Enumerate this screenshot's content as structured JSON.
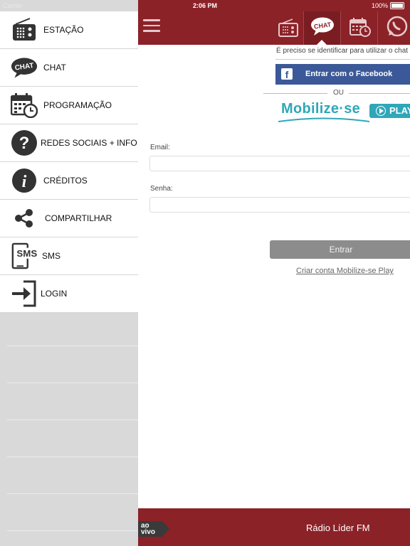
{
  "status_bar": {
    "carrier": "Carrier",
    "time": "2:06 PM",
    "battery": "100%"
  },
  "sidebar": {
    "items": [
      {
        "icon": "radio-icon",
        "label": "ESTAÇÃO"
      },
      {
        "icon": "chat-bubble-icon",
        "label": "CHAT"
      },
      {
        "icon": "calendar-clock-icon",
        "label": "PROGRAMAÇÃO"
      },
      {
        "icon": "question-icon",
        "label": "REDES SOCIAIS + INFO"
      },
      {
        "icon": "info-icon",
        "label": "CRÉDITOS"
      },
      {
        "icon": "share-icon",
        "label": "COMPARTILHAR"
      },
      {
        "icon": "sms-phone-icon",
        "label": "SMS"
      },
      {
        "icon": "login-icon",
        "label": "LOGIN"
      }
    ]
  },
  "header": {
    "icons": [
      "menu-icon",
      "radio-icon",
      "chat-icon",
      "calendar-icon",
      "whatsapp-icon"
    ],
    "chat_icon_text": "CHAT",
    "accent": "#8b2228"
  },
  "login": {
    "notice": "É preciso se identificar para utilizar o chat",
    "facebook_label": "Entrar com o Facebook",
    "or_label": "OU",
    "brand": "Mobilize·se",
    "play_badge": "PLAY",
    "email_label": "Email:",
    "email_value": "",
    "password_label": "Senha:",
    "password_value": "",
    "submit_label": "Entrar",
    "create_account_label": "Criar conta Mobilize-se Play"
  },
  "footer": {
    "live_badge_line1": "ao",
    "live_badge_line2": "vivo",
    "station_name": "Rádio Líder FM"
  }
}
